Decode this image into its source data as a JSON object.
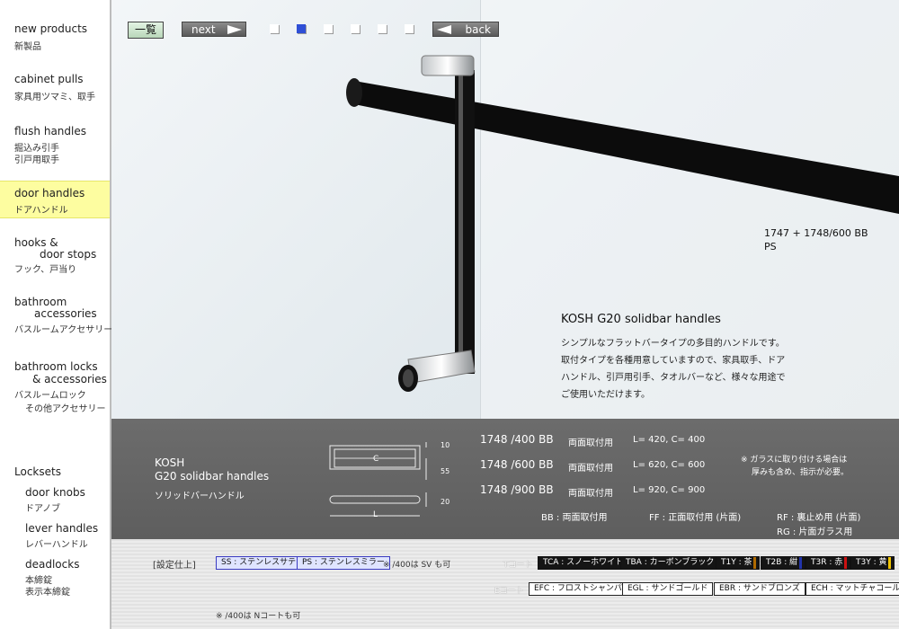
{
  "sidebar": {
    "items": [
      {
        "en": "new products",
        "jp": "新製品"
      },
      {
        "en": "cabinet pulls",
        "jp": "家具用ツマミ、取手"
      },
      {
        "en": "flush handles",
        "jp": "掘込み引手",
        "jp2": "引戸用取手"
      },
      {
        "en": "door handles",
        "jp": "ドアハンドル"
      },
      {
        "en": "hooks &",
        "en2": "door stops",
        "jp": "フック、戸当り"
      },
      {
        "en": "bathroom",
        "en2": "accessories",
        "jp": "バスルームアクセサリー"
      },
      {
        "en": "bathroom locks",
        "en2": "& accessories",
        "jp": "バスルームロック",
        "jp2": "その他アクセサリー"
      },
      {
        "en": "Locksets"
      },
      {
        "en": "door knobs",
        "jp": "ドアノブ"
      },
      {
        "en": "lever handles",
        "jp": "レバーハンドル"
      },
      {
        "en": "deadlocks",
        "jp": "本締錠",
        "jp2": "表示本締錠"
      }
    ]
  },
  "nav": {
    "list": "一覧",
    "next": "next",
    "back": "back",
    "dots": 6,
    "active_dot": 2
  },
  "photo": {
    "model_line1": "1747 + 1748/600  BB",
    "model_line2": "PS",
    "title": "KOSH  G20 solidbar handles",
    "desc": [
      "シンプルなフラットバータイプの多目的ハンドルです。",
      "取付タイプを各種用意していますので、家具取手、ドア",
      "ハンドル、引戸用引手、タオルバーなど、様々な用途で",
      "ご使用いただけます。"
    ]
  },
  "spec": {
    "brand": "KOSH",
    "name": "G20 solidbar handles",
    "jp": "ソリッドバーハンドル",
    "diagram": {
      "c": "C",
      "l": "L",
      "d1": "10",
      "d2": "55",
      "d3": "20"
    },
    "rows": [
      {
        "model": "1748 /400 BB",
        "mount": "両面取付用",
        "dim": "L= 420,   C= 400"
      },
      {
        "model": "1748 /600 BB",
        "mount": "両面取付用",
        "dim": "L= 620,   C= 600"
      },
      {
        "model": "1748 /900 BB",
        "mount": "両面取付用",
        "dim": "L= 920,   C= 900"
      }
    ],
    "note1": "※ ガラスに取り付ける場合は",
    "note2": "厚みも含め、指示が必要。",
    "codes": {
      "bb": "BB : 両面取付用",
      "ff": "FF : 正面取付用 (片面)",
      "rf": "RF : 裏止め用 (片面)",
      "rg": "RG : 片面ガラス用"
    }
  },
  "finish": {
    "label": "[設定仕上]",
    "ss": "SS : ステンレスサテン",
    "ps": "PS : ステンレスミラー",
    "note_sv": "※ /400は SV も可",
    "t_label": "Tコート",
    "t_items": [
      {
        "text": "TCA : スノーホワイト"
      },
      {
        "text": "TBA : カーボンブラック"
      },
      {
        "text": "T1Y : 茶",
        "color": "#b06a00"
      },
      {
        "text": "T2B : 紺",
        "color": "#2233aa"
      },
      {
        "text": "T3R : 赤",
        "color": "#cc1111"
      },
      {
        "text": "T3Y : 黄",
        "color": "#f0c400"
      }
    ],
    "e_label": "Eコート",
    "e_items": [
      {
        "text": "EFC : フロストシャンパン"
      },
      {
        "text": "EGL : サンドゴールド"
      },
      {
        "text": "EBR : サンドブロンズ"
      },
      {
        "text": "ECH : マットチャコール"
      }
    ],
    "note_n": "※ /400は Nコートも可"
  },
  "colors": {
    "active_nav": "#fdfda0",
    "active_dot": "#2f4fd6",
    "band": "#666666"
  }
}
